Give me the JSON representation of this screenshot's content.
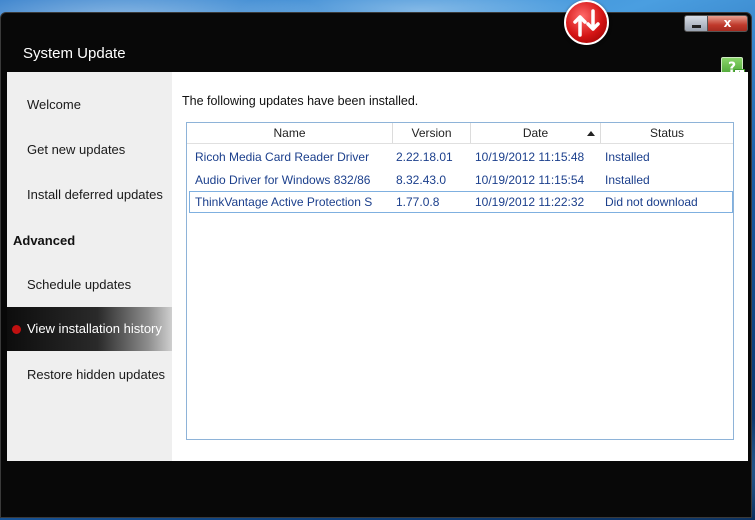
{
  "window": {
    "title": "System Update",
    "close_label": "x",
    "help_label": "?"
  },
  "sidebar": {
    "items": [
      {
        "label": "Welcome"
      },
      {
        "label": "Get new updates"
      },
      {
        "label": "Install deferred updates"
      }
    ],
    "heading": "Advanced",
    "advanced_items": [
      {
        "label": "Schedule updates"
      },
      {
        "label": "View installation history",
        "active": true
      },
      {
        "label": "Restore hidden updates"
      }
    ]
  },
  "main": {
    "intro": "The following updates have been installed.",
    "columns": [
      "Name",
      "Version",
      "Date",
      "Status"
    ],
    "sort_column": "Date",
    "rows": [
      {
        "name": "Ricoh Media Card Reader Driver",
        "version": "2.22.18.01",
        "date": "10/19/2012 11:15:48",
        "status": "Installed"
      },
      {
        "name": "Audio Driver for Windows 832/86",
        "version": "8.32.43.0",
        "date": "10/19/2012 11:15:54",
        "status": "Installed"
      },
      {
        "name": "ThinkVantage Active Protection S",
        "version": "1.77.0.8",
        "date": "10/19/2012 11:22:32",
        "status": "Did not download"
      }
    ]
  },
  "colors": {
    "link_text": "#1b3f8c",
    "active_dot": "#c01010",
    "window_frame": "#080808"
  }
}
